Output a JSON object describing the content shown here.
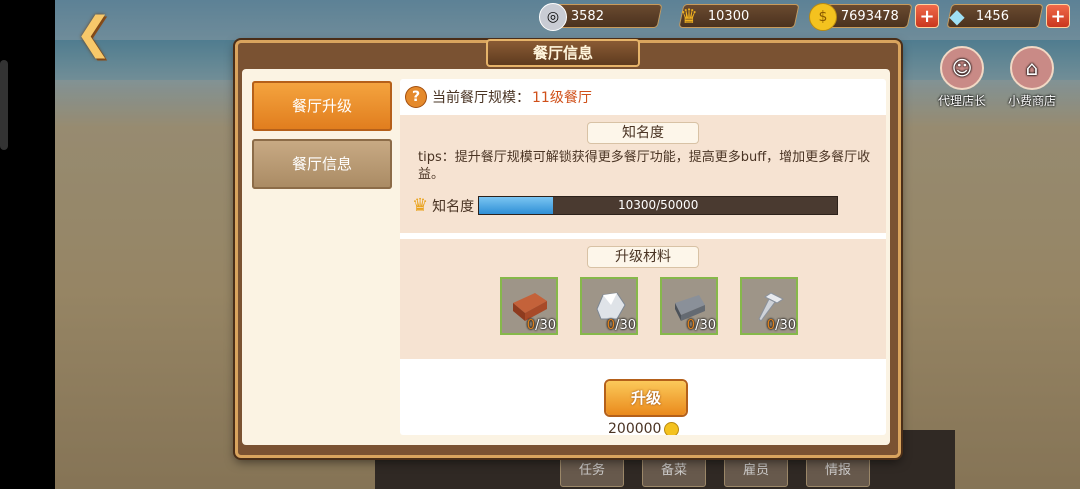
{
  "resources": [
    {
      "icon": "silver-coin-icon",
      "value": "3582",
      "plus": false
    },
    {
      "icon": "crown-icon",
      "value": "10300",
      "plus": false
    },
    {
      "icon": "gold-coin-icon",
      "value": "7693478",
      "plus": true
    },
    {
      "icon": "diamond-icon",
      "value": "1456",
      "plus": true
    }
  ],
  "side_buttons": {
    "manager": "代理店长",
    "shop": "小费商店"
  },
  "dialog": {
    "title": "餐厅信息",
    "tabs": [
      {
        "label": "餐厅升级",
        "active": true
      },
      {
        "label": "餐厅信息",
        "active": false
      }
    ],
    "scale_label": "当前餐厅规模：",
    "scale_value": "11级餐厅",
    "fame_header": "知名度",
    "tips": "tips：提升餐厅规模可解锁获得更多餐厅功能，提高更多buff，增加更多餐厅收益。",
    "fame_label": "知名度",
    "fame_current": 10300,
    "fame_max": 50000,
    "fame_text": "10300/50000",
    "materials_header": "升级材料",
    "materials": [
      {
        "icon": "brick-icon",
        "have": "0",
        "need": "/30"
      },
      {
        "icon": "stone-icon",
        "have": "0",
        "need": "/30"
      },
      {
        "icon": "iron-ingot-icon",
        "have": "0",
        "need": "/30"
      },
      {
        "icon": "nail-icon",
        "have": "0",
        "need": "/30"
      }
    ],
    "upgrade_label": "升级",
    "cost": "200000"
  },
  "bottom_tabs": [
    "任务",
    "备菜",
    "雇员",
    "情报"
  ]
}
